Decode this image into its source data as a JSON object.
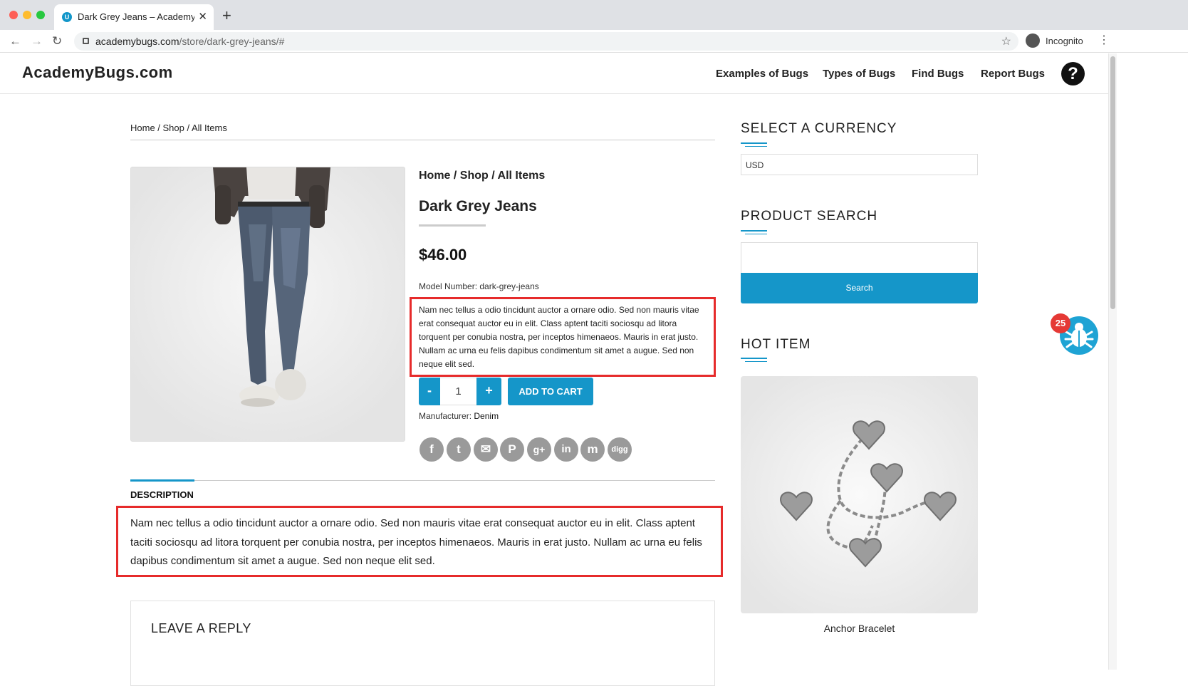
{
  "browser": {
    "tab_title": "Dark Grey Jeans – AcademyBugs.com",
    "url_host": "academybugs.com",
    "url_path": "/store/dark-grey-jeans/#",
    "incognito_label": "Incognito",
    "new_tab": "+",
    "tab_close": "✕",
    "favicon_letter": "U"
  },
  "site": {
    "logo": "AcademyBugs.com",
    "nav": [
      "Examples of Bugs",
      "Types of Bugs",
      "Find Bugs",
      "Report Bugs"
    ],
    "help": "?"
  },
  "breadcrumb": "Home / Shop / All Items",
  "product": {
    "breadcrumb": "Home / Shop / All Items",
    "title": "Dark Grey Jeans",
    "price": "$46.00",
    "model_label": "Model Number:",
    "model_value": "dark-grey-jeans",
    "short_description": "Nam nec tellus a odio tincidunt auctor a ornare odio. Sed non mauris vitae erat consequat auctor eu in elit. Class aptent taciti sociosqu ad litora torquent per conubia nostra, per inceptos himenaeos. Mauris in erat justo. Nullam ac urna eu felis dapibus condimentum sit amet a augue. Sed non neque elit sed.",
    "qty_minus": "-",
    "qty_value": "1",
    "qty_plus": "+",
    "add_to_cart": "ADD TO CART",
    "manufacturer_label": "Manufacturer:",
    "manufacturer_value": "Denim",
    "social": [
      "f",
      "t",
      "✉",
      "P",
      "g+",
      "in",
      "m",
      "digg"
    ]
  },
  "description": {
    "tab_label": "DESCRIPTION",
    "body": "Nam nec tellus a odio tincidunt auctor a ornare odio. Sed non mauris vitae erat consequat auctor eu in elit. Class aptent taciti sociosqu ad litora torquent per conubia nostra, per inceptos himenaeos. Mauris in erat justo. Nullam ac urna eu felis dapibus condimentum sit amet a augue. Sed non neque elit sed."
  },
  "reply": {
    "title": "LEAVE A REPLY"
  },
  "sidebar": {
    "currency_heading": "SELECT A CURRENCY",
    "currency_value": "USD",
    "search_heading": "PRODUCT SEARCH",
    "search_button": "Search",
    "hot_heading": "HOT ITEM",
    "hot_item_name": "Anchor Bracelet"
  },
  "bug_widget": {
    "count": "25"
  },
  "colors": {
    "accent": "#1596c9",
    "highlight_box": "#e62b2b",
    "badge": "#e53935"
  }
}
